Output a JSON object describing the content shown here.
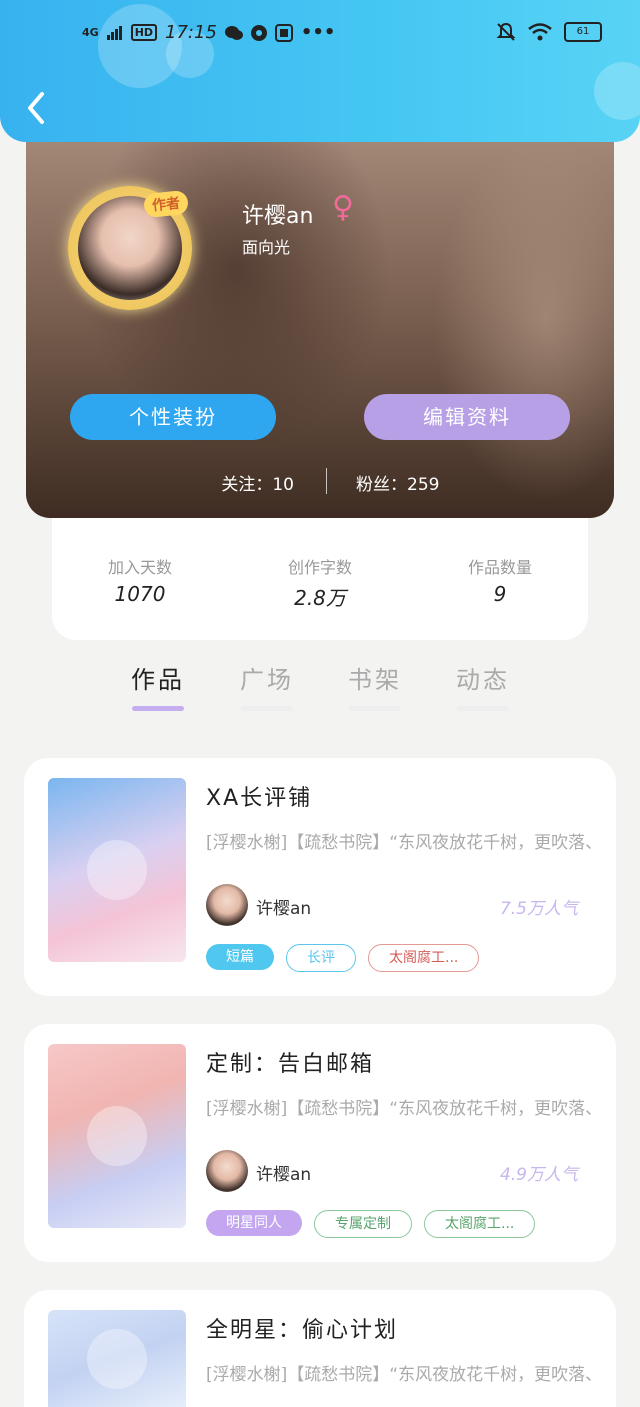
{
  "status_bar": {
    "network": "4G",
    "hd": "HD",
    "time": "17:15",
    "battery": "61"
  },
  "profile": {
    "badge": "作者",
    "username": "许樱an",
    "gender_symbol": "♀",
    "motto": "面向光",
    "dress_button": "个性装扮",
    "edit_button": "编辑资料",
    "following": "关注：10",
    "fans": "粉丝：259"
  },
  "stats": [
    {
      "label": "加入天数",
      "value": "1070"
    },
    {
      "label": "创作字数",
      "value": "2.8万"
    },
    {
      "label": "作品数量",
      "value": "9"
    }
  ],
  "tabs": [
    {
      "label": "作品",
      "active": true
    },
    {
      "label": "广场",
      "active": false
    },
    {
      "label": "书架",
      "active": false
    },
    {
      "label": "动态",
      "active": false
    }
  ],
  "works": [
    {
      "title": "XA长评铺",
      "intro": "[浮樱水榭]【疏愁书院】“东风夜放花千树，更吹落、星如雨。",
      "author": "许樱an",
      "popularity": "7.5万人气",
      "tags": [
        "短篇",
        "长评",
        "太阁腐工..."
      ]
    },
    {
      "title": "定制：告白邮箱",
      "intro": "[浮樱水榭]【疏愁书院】“东风夜放花千树，更吹落、星如雨。",
      "author": "许樱an",
      "popularity": "4.9万人气",
      "tags": [
        "明星同人",
        "专属定制",
        "太阁腐工..."
      ]
    },
    {
      "title": "全明星：偷心计划",
      "intro": "[浮樱水榭]【疏愁书院】“东风夜放花千树，更吹落、星如雨。"
    }
  ]
}
